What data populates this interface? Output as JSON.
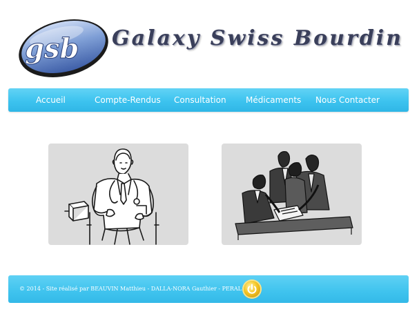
{
  "header": {
    "logo_text": "gsb",
    "site_title": "Galaxy Swiss Bourdin"
  },
  "nav": {
    "items": [
      {
        "label": "Accueil"
      },
      {
        "label": "Compte-Rendus"
      },
      {
        "label": "Consultation"
      },
      {
        "label": "Médicaments"
      },
      {
        "label": "Nous Contacter"
      }
    ]
  },
  "footer": {
    "text": "© 2014 - Site réalisé par   BEAUVIN Matthieu - DALLA-NORA Gauthier - PERAL Rémi",
    "power_icon": "power-icon"
  },
  "colors": {
    "nav_background": "#3dc3ef",
    "title_color": "#3a3f5a",
    "panel_background": "#dcdcdc",
    "power_button": "#f5c623"
  }
}
